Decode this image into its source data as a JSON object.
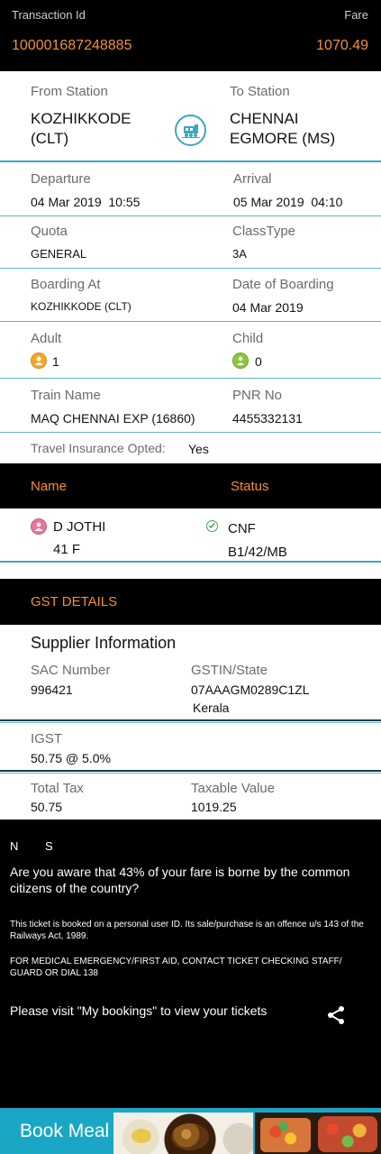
{
  "header": {
    "transaction_label": "Transaction Id",
    "transaction_value": "100001687248885",
    "fare_label": "Fare",
    "fare_value": "1070.49"
  },
  "journey": {
    "from_label": "From Station",
    "from_value": "KOZHIKKODE (CLT)",
    "to_label": "To Station",
    "to_value": "CHENNAI EGMORE (MS)",
    "train_icon": "train-icon",
    "departure_label": "Departure",
    "departure_value": "04 Mar 2019  10:55",
    "arrival_label": "Arrival",
    "arrival_value": "05 Mar 2019  04:10",
    "quota_label": "Quota",
    "quota_value": "GENERAL",
    "class_label": "ClassType",
    "class_value": "3A",
    "boarding_label": "Boarding At",
    "boarding_value": "KOZHIKKODE (CLT)",
    "date_boarding_label": "Date of Boarding",
    "date_boarding_value": "04 Mar 2019",
    "adult_label": "Adult",
    "adult_value": "1",
    "child_label": "Child",
    "child_value": "0",
    "train_name_label": "Train Name",
    "train_name_value": "MAQ CHENNAI EXP (16860)",
    "pnr_label": "PNR No",
    "pnr_value": "4455332131",
    "insurance_label": "Travel Insurance Opted:",
    "insurance_value": "Yes"
  },
  "passengers": {
    "name_header": "Name",
    "status_header": "Status",
    "rows": [
      {
        "name": "D JOTHI",
        "age_gender": "41 F",
        "status": "CNF",
        "berth": "B1/42/MB"
      }
    ]
  },
  "gst": {
    "title": "GST DETAILS",
    "supplier_title": "Supplier Information",
    "sac_label": "SAC Number",
    "sac_value": "996421",
    "gstin_label": "GSTIN/State",
    "gstin_value": "07AAAGM0289C1ZL",
    "state_value": "Kerala",
    "igst_label": "IGST",
    "igst_value": "50.75 @ 5.0%",
    "total_tax_label": "Total Tax",
    "total_tax_value": "50.75",
    "taxable_label": "Taxable Value",
    "taxable_value": "1019.25"
  },
  "notes": {
    "n_label": "N",
    "s_label": "S",
    "awareness": "Are you aware that 43% of your fare is borne by the common citizens of the country?",
    "personal_id": "This ticket is booked on a personal user ID. Its sale/purchase is an offence u/s 143 of the Railways Act, 1989.",
    "medical": "FOR MEDICAL EMERGENCY/FIRST AID, CONTACT TICKET CHECKING STAFF/ GUARD OR DIAL 138",
    "visit": "Please visit \"My bookings\" to view your tickets",
    "share_icon": "share-icon"
  },
  "book_meal": {
    "label": "Book Meal"
  },
  "colors": {
    "accent_orange": "#f29031",
    "teal": "#3da6c1",
    "book_meal_bg": "#1aa7c5"
  }
}
